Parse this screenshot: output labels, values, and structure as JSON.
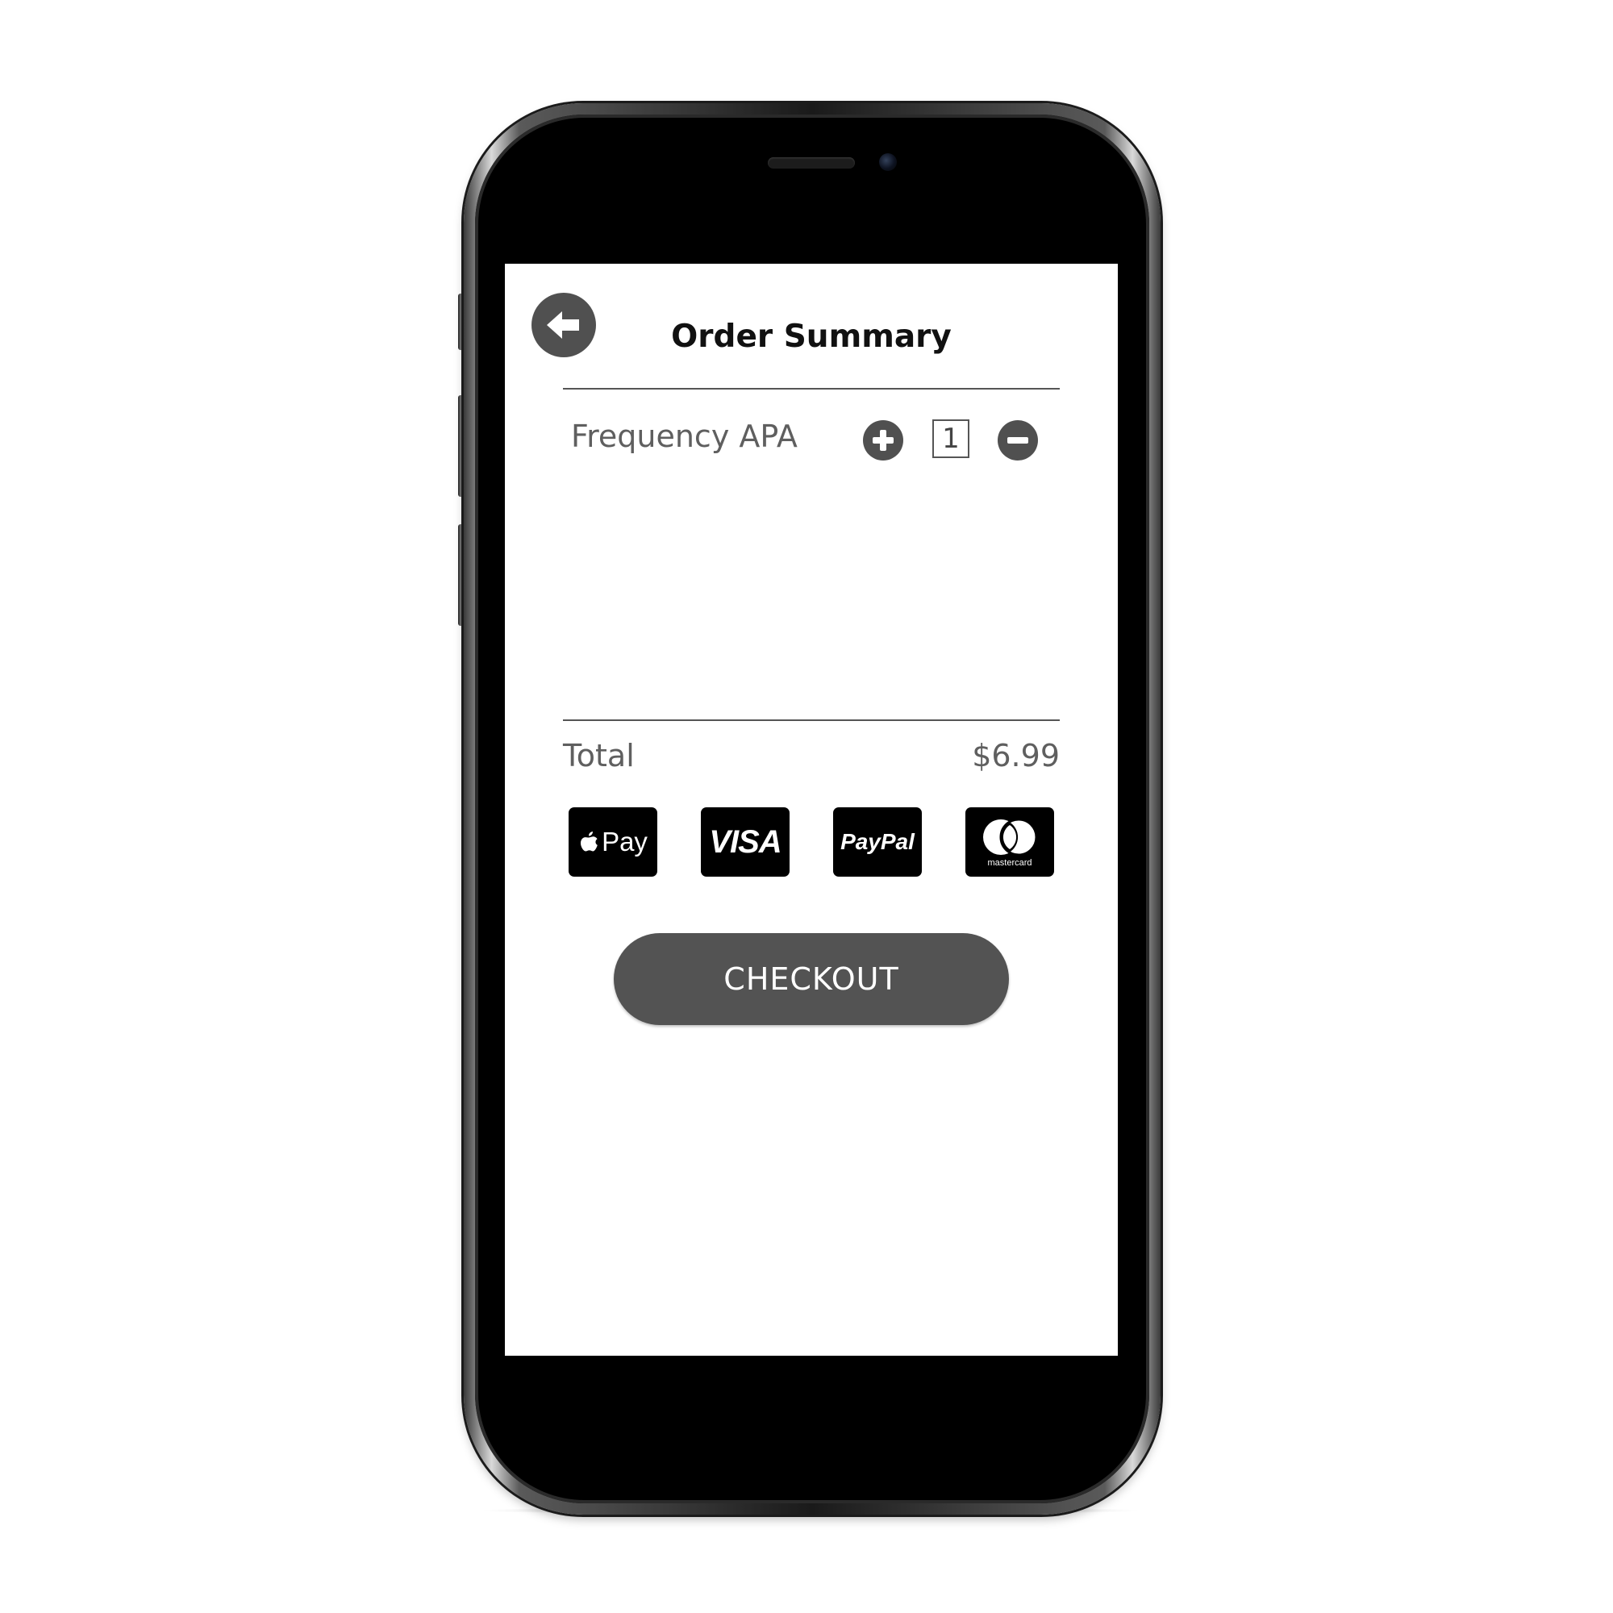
{
  "screen": {
    "title": "Order Summary",
    "item": {
      "name": "Frequency APA",
      "quantity": "1"
    },
    "total": {
      "label": "Total",
      "value": "$6.99"
    },
    "payment_methods": [
      {
        "name": "Apple Pay",
        "logo_text": "Pay",
        "icon": "apple-icon"
      },
      {
        "name": "Visa",
        "logo_text": "VISA"
      },
      {
        "name": "PayPal",
        "logo_text": "PayPal"
      },
      {
        "name": "Mastercard",
        "logo_text": "mastercard"
      }
    ],
    "checkout_label": "CHECKOUT"
  },
  "icons": {
    "back": "arrow-left-circle-icon",
    "increase": "plus-circle-icon",
    "decrease": "minus-circle-icon"
  },
  "colors": {
    "icon_gray": "#505050",
    "button_gray": "#535353",
    "text_gray": "#5f5f5f",
    "title_black": "#111111",
    "payment_black": "#000000"
  }
}
